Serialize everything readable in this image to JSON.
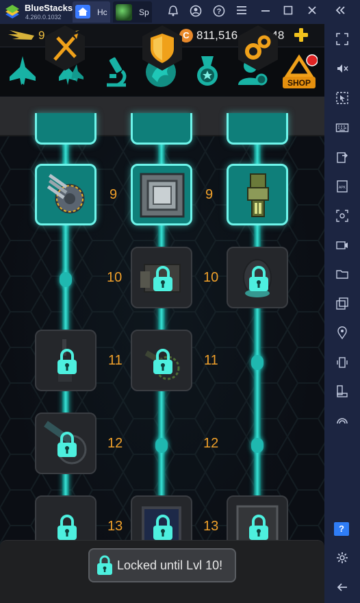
{
  "window": {
    "app_name": "BlueStacks",
    "version": "4.260.0.1032",
    "tabs": [
      {
        "label": "Hc"
      },
      {
        "label": "Sp"
      }
    ]
  },
  "game": {
    "player_level": "9",
    "coins": "811,516",
    "gems": "148",
    "shop_label": "SHOP",
    "rows": [
      {
        "level": "9"
      },
      {
        "level": "10"
      },
      {
        "level": "11"
      },
      {
        "level": "12"
      },
      {
        "level": "13"
      }
    ],
    "col2_levels": [
      "9",
      "10",
      "11",
      "12",
      "13"
    ],
    "toast": "Locked until Lvl 10!"
  },
  "colors": {
    "accent_cyan": "#37e3d6",
    "level_orange": "#f0a02a",
    "titlebar_bg": "#1c2541"
  }
}
